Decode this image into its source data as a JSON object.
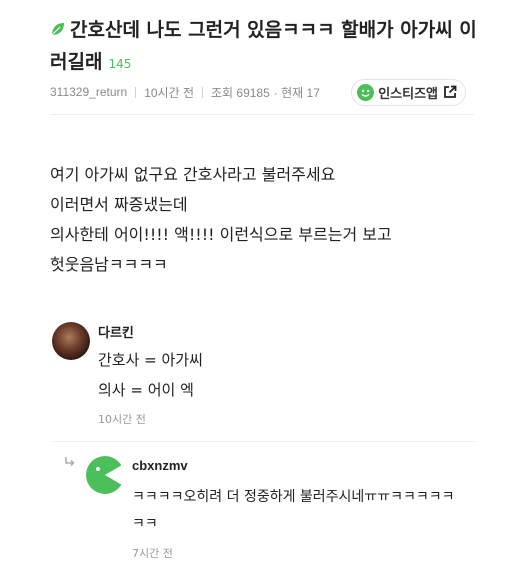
{
  "post": {
    "title": "간호산데 나도 그런거 있음ㅋㅋㅋ 할배가 아가씨 이러길래",
    "comment_count": "145",
    "meta": {
      "author": "311329_return",
      "time": "10시간 전",
      "views": "조회 69185",
      "current": "· 현재 17"
    },
    "share_button_label": "인스티즈앱",
    "body_lines": [
      "여기 아가씨 없구요 간호사라고 불러주세요",
      "이러면서 짜증냈는데",
      "의사한테 어이!!!! 액!!!! 이런식으로 부르는거 보고",
      "헛웃음남ㅋㅋㅋㅋ"
    ]
  },
  "comments": [
    {
      "author": "다르킨",
      "lines": [
        "간호사 = 아가씨",
        "의사 = 어이 엑"
      ],
      "time": "10시간 전"
    },
    {
      "author": "cbxnzmv",
      "text": "ㅋㅋㅋㅋ오히려 더 정중하게 불러주시네ㅠㅠㅋㅋㅋㅋㅋㅋㅋ",
      "time": "7시간 전"
    }
  ],
  "colors": {
    "accent_green": "#4bbf5a",
    "meta_gray": "#8a8a8a"
  },
  "icons": [
    "leaf-icon",
    "smile-icon",
    "share-icon",
    "reply-arrow-icon",
    "avatar"
  ]
}
